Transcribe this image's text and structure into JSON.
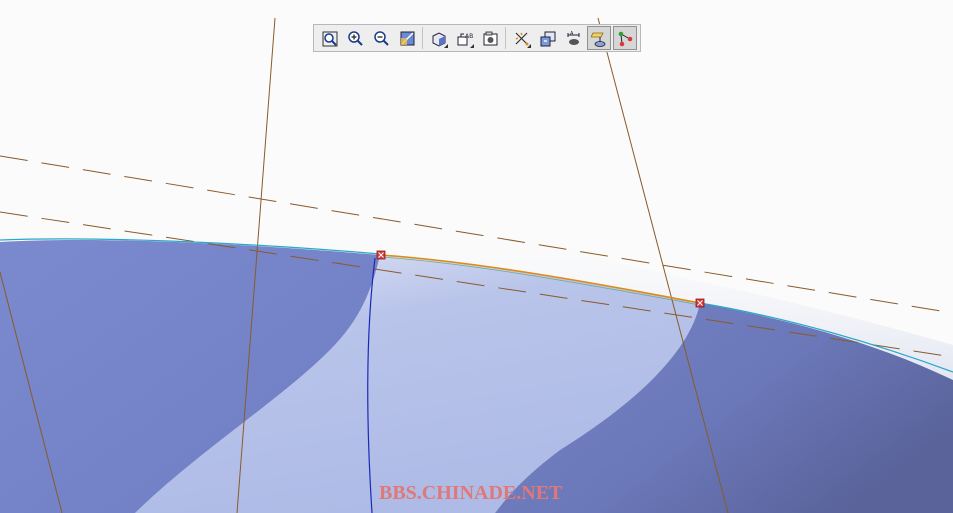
{
  "toolbar": {
    "buttons": [
      {
        "icon": "zoom-fit-icon",
        "active": false,
        "flyout": false
      },
      {
        "icon": "zoom-in-icon",
        "active": false,
        "flyout": false
      },
      {
        "icon": "zoom-out-icon",
        "active": false,
        "flyout": false
      },
      {
        "icon": "refit-icon",
        "active": false,
        "flyout": false
      },
      {
        "icon": "display-style-icon",
        "active": false,
        "flyout": true
      },
      {
        "icon": "saved-views-icon",
        "active": false,
        "flyout": true
      },
      {
        "icon": "view-manager-icon",
        "active": false,
        "flyout": false
      },
      {
        "icon": "datum-display-icon",
        "active": false,
        "flyout": true
      },
      {
        "icon": "spin-center-icon",
        "active": false,
        "flyout": false
      },
      {
        "icon": "annotation-display-icon",
        "active": false,
        "flyout": false
      },
      {
        "icon": "plane-tag-display-icon",
        "active": true,
        "flyout": false
      },
      {
        "icon": "point-display-icon",
        "active": true,
        "flyout": false
      }
    ]
  },
  "watermark": "BBS.CHINADE.NET",
  "colors": {
    "background": "#fbfbfb",
    "surface_dark": "#7280c4",
    "surface_light": "#b8c3ec",
    "datum_line": "#8a5a2a",
    "edge_cyan": "#2aa8c8",
    "edge_blue": "#1a2ab8",
    "curve_orange": "#e08a10",
    "point_marker": "#d83a3a",
    "watermark": "#e07878"
  }
}
